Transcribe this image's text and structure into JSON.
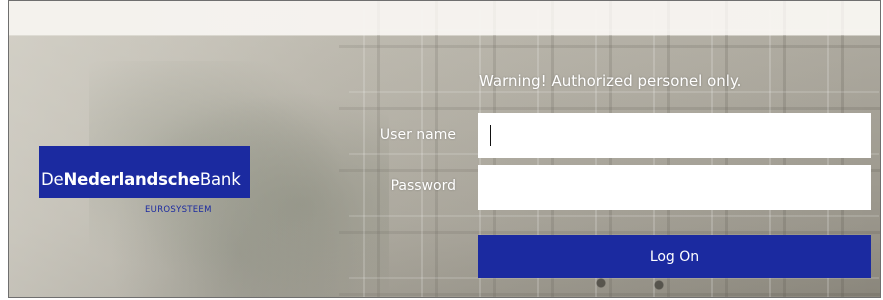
{
  "logo": {
    "name_part1": "De",
    "name_part2": "Nederlandsche",
    "name_part3": "Bank",
    "subtitle": "EUROSYSTEEM"
  },
  "form": {
    "warning": "Warning! Authorized personel only.",
    "username_label": "User name",
    "username_value": "",
    "password_label": "Password",
    "password_value": "",
    "submit_label": "Log On"
  },
  "colors": {
    "brand_blue": "#1b2aa0",
    "field_bg": "#ffffff",
    "label_text": "#ffffff"
  }
}
